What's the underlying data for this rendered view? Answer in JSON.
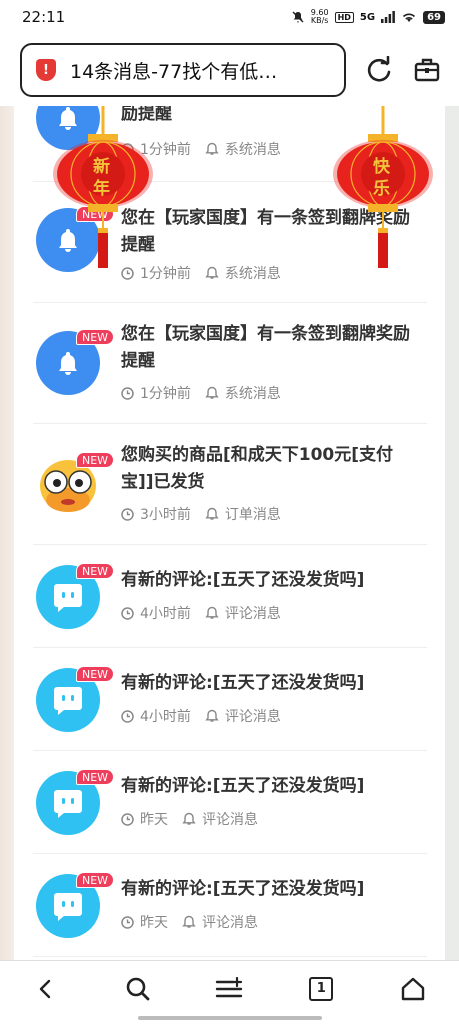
{
  "status_bar": {
    "time": "22:11",
    "net_speed_value": "9.60",
    "net_speed_unit": "KB/s",
    "hd": "HD",
    "signal": "5G",
    "battery": "69"
  },
  "browser": {
    "url_title": "14条消息-77找个有低…",
    "security_icon": "shield-alert-icon"
  },
  "lanterns": {
    "left_text": [
      "新",
      "年"
    ],
    "right_text": [
      "快",
      "乐"
    ]
  },
  "badge_label": "NEW",
  "messages": [
    {
      "avatar": "bell",
      "title": "励提醒",
      "time": "1分钟前",
      "type": "系统消息",
      "new": false
    },
    {
      "avatar": "bell",
      "title": "您在【玩家国度】有一条签到翻牌奖励提醒",
      "time": "1分钟前",
      "type": "系统消息",
      "new": true
    },
    {
      "avatar": "bell",
      "title": "您在【玩家国度】有一条签到翻牌奖励提醒",
      "time": "1分钟前",
      "type": "系统消息",
      "new": true
    },
    {
      "avatar": "emoji",
      "title": "您购买的商品[和成天下100元[支付宝]]已发货",
      "time": "3小时前",
      "type": "订单消息",
      "new": true
    },
    {
      "avatar": "chat",
      "title": "有新的评论:[五天了还没发货吗]",
      "time": "4小时前",
      "type": "评论消息",
      "new": true
    },
    {
      "avatar": "chat",
      "title": "有新的评论:[五天了还没发货吗]",
      "time": "4小时前",
      "type": "评论消息",
      "new": true
    },
    {
      "avatar": "chat",
      "title": "有新的评论:[五天了还没发货吗]",
      "time": "昨天",
      "type": "评论消息",
      "new": true
    },
    {
      "avatar": "chat",
      "title": "有新的评论:[五天了还没发货吗]",
      "time": "昨天",
      "type": "评论消息",
      "new": true
    }
  ],
  "nav": {
    "tab_count": "1",
    "icons": [
      "back-icon",
      "search-icon",
      "menu-icon",
      "tabs-icon",
      "home-icon"
    ]
  },
  "colors": {
    "badge": "#ef3e5b",
    "bell_avatar": "#3d8ef0",
    "chat_avatar": "#2ec1f2",
    "lantern_red": "#e8231d",
    "lantern_gold": "#f5b32a"
  }
}
